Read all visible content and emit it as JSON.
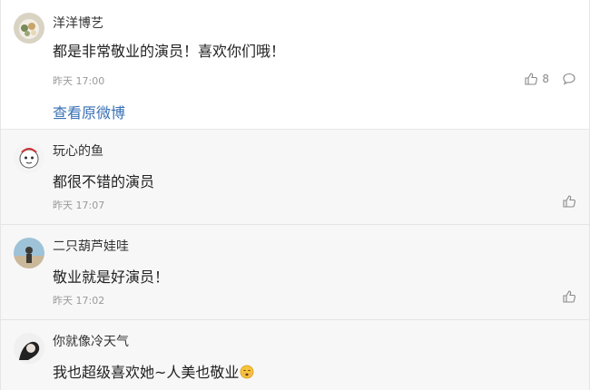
{
  "comments": [
    {
      "user": "洋洋博艺",
      "text": "都是非常敬业的演员！喜欢你们哦！",
      "time": "昨天 17:00",
      "likes": "8"
    },
    {
      "user": "玩心的鱼",
      "text": "都很不错的演员",
      "time": "昨天 17:07"
    },
    {
      "user": "二只葫芦娃哇",
      "text": "敬业就是好演员！",
      "time": "昨天 17:02"
    },
    {
      "user": "你就像冷天气",
      "text": "我也超级喜欢她~人美也敬业"
    }
  ],
  "view_original_label": "查看原微博",
  "icons": {
    "like": "thumbs-up-icon",
    "reply": "comment-bubble-icon",
    "emoji": "smiling-face-emoji"
  },
  "colors": {
    "link": "#3a71b5",
    "sub_bg": "#f7f7f7",
    "muted": "#999999"
  }
}
